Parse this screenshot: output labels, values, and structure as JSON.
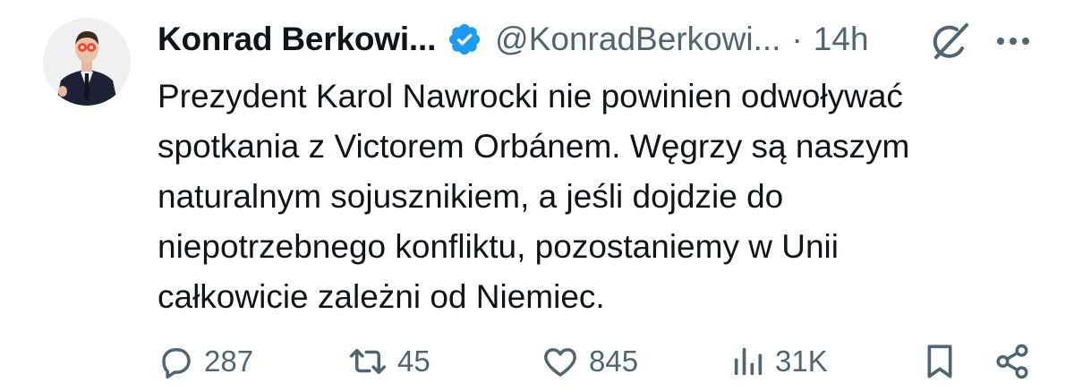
{
  "author": {
    "display_name": "Konrad Berkowi...",
    "handle": "@KonradBerkowi...",
    "separator": "·",
    "time_ago": "14h",
    "verified_color": "#1d9bf0"
  },
  "tweet": {
    "text": "Prezydent Karol Nawrocki nie powinien odwoływać\nspotkania z Victorem Orbánem. Węgrzy są naszym\nnaturalnym sojusznikiem, a jeśli dojdzie do\nniepotrzebnego konfliktu, pozostaniemy w Unii\ncałkowicie zależni od Niemiec."
  },
  "actions": {
    "replies": "287",
    "reposts": "45",
    "likes": "845",
    "views": "31K"
  },
  "icons": {
    "reply": "speech-bubble-icon",
    "repost": "repost-arrows-icon",
    "like": "heart-icon",
    "views": "bar-chart-icon",
    "bookmark": "bookmark-icon",
    "share": "share-icon",
    "grok": "grok-icon",
    "more": "more-dots-icon"
  },
  "colors": {
    "text_primary": "#0f1419",
    "text_secondary": "#536471",
    "accent": "#1d9bf0"
  }
}
